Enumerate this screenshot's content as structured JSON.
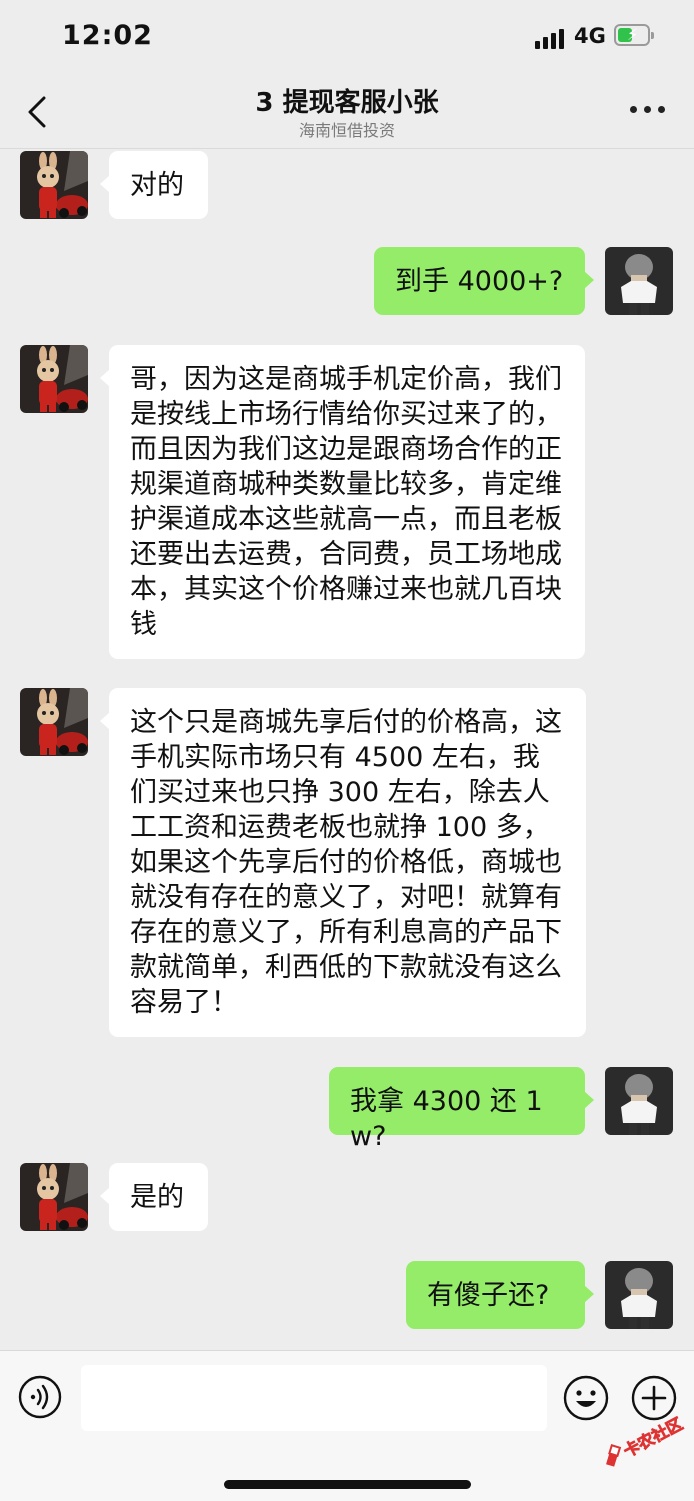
{
  "status_bar": {
    "time": "12:02",
    "network": "4G",
    "battery_color": "#30c24b"
  },
  "nav": {
    "title": "3 提现客服小张",
    "subtitle": "海南恒借投资"
  },
  "messages": [
    {
      "side": "left",
      "text": "对的"
    },
    {
      "side": "right",
      "text": "到手 4000+?"
    },
    {
      "side": "left",
      "text": "哥，因为这是商城手机定价高，我们是按线上市场行情给你买过来了的，而且因为我们这边是跟商场合作的正规渠道商城种类数量比较多，肯定维护渠道成本这些就高一点，而且老板还要出去运费，合同费，员工场地成本，其实这个价格赚过来也就几百块钱"
    },
    {
      "side": "left",
      "text": "这个只是商城先享后付的价格高，这手机实际市场只有 4500 左右，我们买过来也只挣 300 左右，除去人工工资和运费老板也就挣 100 多，如果这个先享后付的价格低，商城也就没有存在的意义了，对吧！就算有存在的意义了，所有利息高的产品下款就简单，利西低的下款就没有这么容易了！"
    },
    {
      "side": "right",
      "text": "我拿 4300 还 1w?"
    },
    {
      "side": "left",
      "text": "是的"
    },
    {
      "side": "right",
      "text": "有傻子还?"
    }
  ],
  "watermark": {
    "text": "卡农社区"
  },
  "colors": {
    "background": "#ededed",
    "bubble_left": "#ffffff",
    "bubble_right": "#95ec69"
  }
}
